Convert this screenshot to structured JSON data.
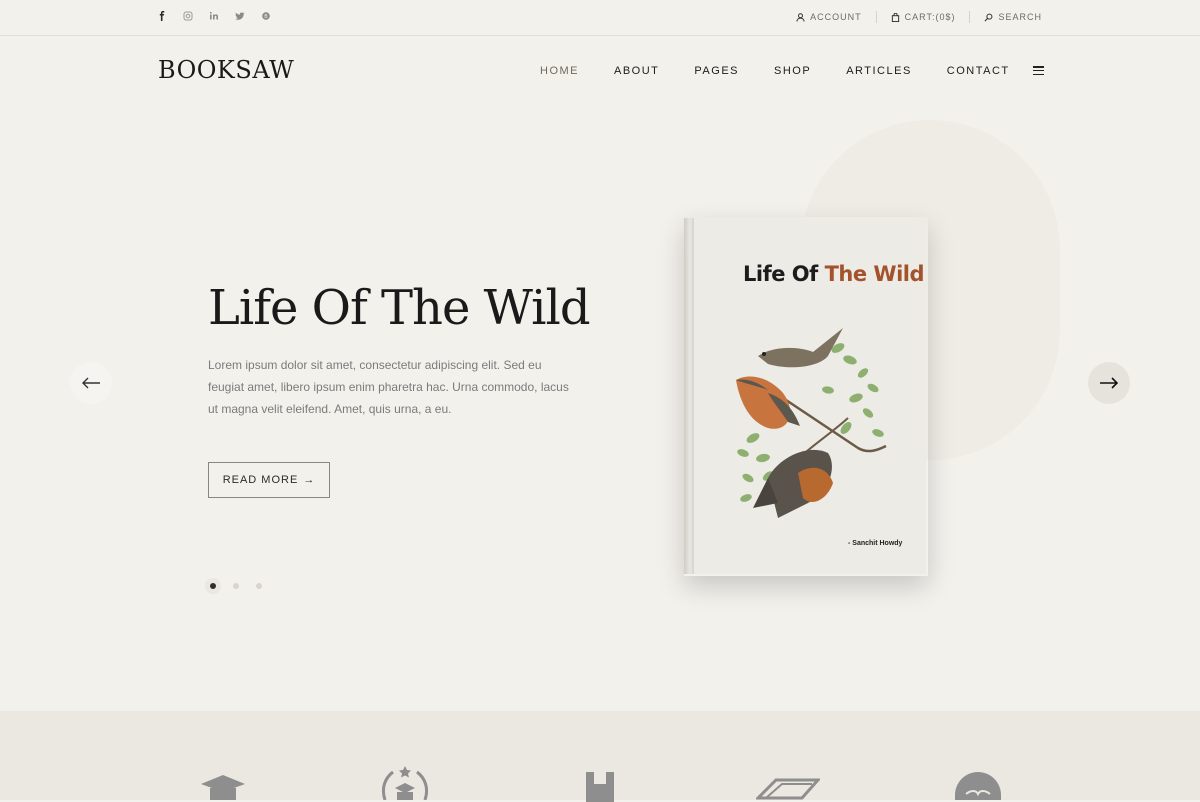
{
  "topbar": {
    "social_icons": [
      "facebook-icon",
      "instagram-icon",
      "linkedin-icon",
      "twitter-icon",
      "behance-icon"
    ],
    "account_label": "ACCOUNT",
    "cart_label": "CART:(0$)",
    "search_label": "SEARCH"
  },
  "header": {
    "logo_bold": "BOOK",
    "logo_light": "SAW",
    "nav": [
      "HOME",
      "ABOUT",
      "PAGES",
      "SHOP",
      "ARTICLES",
      "CONTACT"
    ],
    "active_nav": "HOME"
  },
  "hero": {
    "title": "Life Of The Wild",
    "description": "Lorem ipsum dolor sit amet, consectetur adipiscing elit. Sed eu feugiat amet, libero ipsum enim pharetra hac. Urna commodo, lacus ut magna velit eleifend. Amet, quis urna, a eu.",
    "button_label": "READ MORE",
    "button_arrow": "→",
    "slide_count": 3,
    "active_slide": 1
  },
  "book": {
    "title_part1": "Life Of ",
    "title_part2": "The Wild",
    "author": "- Sanchit Howdy",
    "accent_color": "#a3522c"
  },
  "features": {
    "icons": [
      "graduation-cap-icon",
      "award-books-icon",
      "bookend-icon",
      "book-icon",
      "open-book-badge-icon"
    ]
  },
  "colors": {
    "background": "#f3f1ec",
    "strip": "#ebe8e1",
    "text": "#1a1a1a"
  }
}
